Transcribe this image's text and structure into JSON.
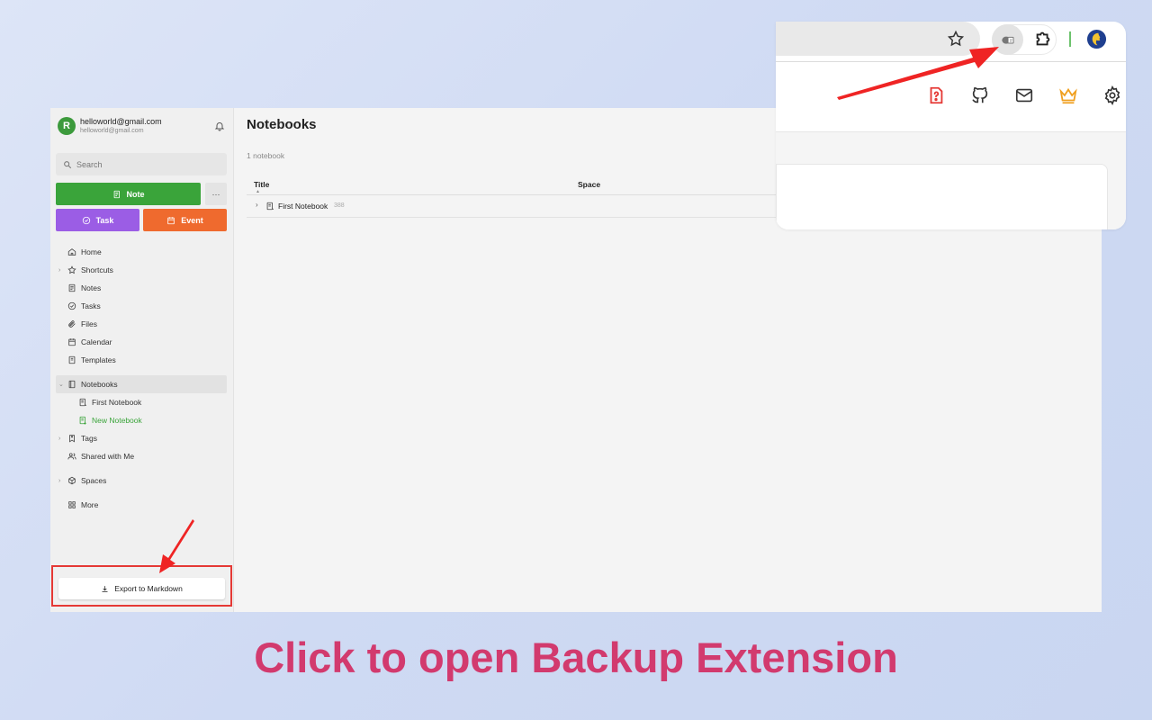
{
  "account": {
    "avatar_letter": "R",
    "email": "helloworld@gmail.com",
    "email_sub": "helloworld@gmail.com"
  },
  "search": {
    "placeholder": "Search"
  },
  "buttons": {
    "note": "Note",
    "more": "···",
    "task": "Task",
    "event": "Event",
    "export": "Export to Markdown"
  },
  "nav": {
    "home": "Home",
    "shortcuts": "Shortcuts",
    "notes": "Notes",
    "tasks": "Tasks",
    "files": "Files",
    "calendar": "Calendar",
    "templates": "Templates",
    "notebooks": "Notebooks",
    "first_notebook": "First Notebook",
    "new_notebook": "New Notebook",
    "tags": "Tags",
    "shared": "Shared with Me",
    "spaces": "Spaces",
    "more": "More"
  },
  "main": {
    "title": "Notebooks",
    "count": "1 notebook",
    "columns": [
      "Title",
      "Space"
    ],
    "rows": [
      {
        "name": "First Notebook",
        "count": "388"
      }
    ]
  },
  "colors": {
    "note": "#3aa43a",
    "task": "#9b5de5",
    "event": "#ef6a2e",
    "highlight": "#e53935",
    "caption": "#d23a6e"
  },
  "caption": "Click to open Backup Extension"
}
